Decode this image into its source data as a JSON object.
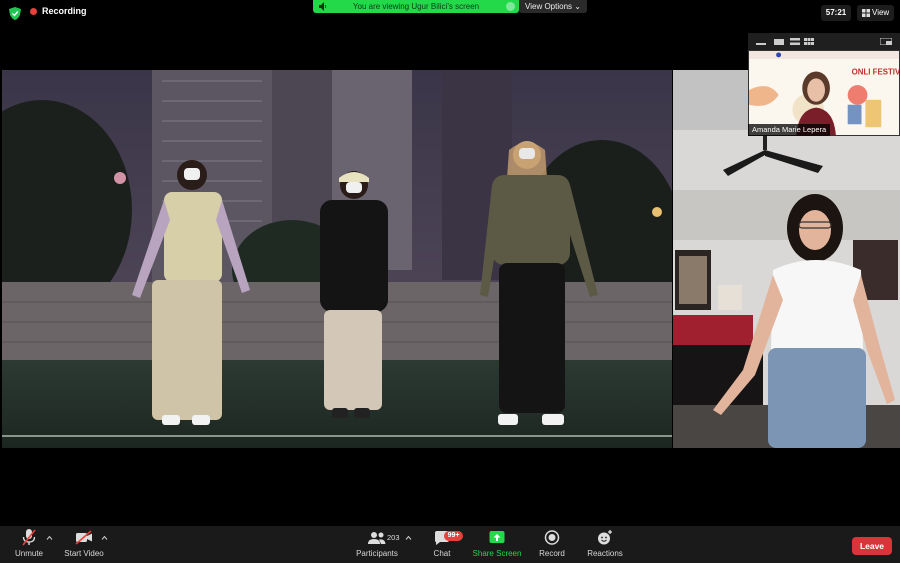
{
  "meeting": {
    "recording_label": "Recording",
    "viewing_banner": "You are viewing Ugur Bilici's screen",
    "view_options_label": "View Options",
    "timer": "57:21",
    "view_label": "View"
  },
  "thumbnail": {
    "participant_name": "Amanda Marie Lepera",
    "background_text": "ONLI FESTIVAL"
  },
  "toolbar": {
    "unmute_label": "Unmute",
    "start_video_label": "Start Video",
    "participants_label": "Participants",
    "participants_count": "203",
    "chat_label": "Chat",
    "chat_badge": "99+",
    "share_screen_label": "Share Screen",
    "record_label": "Record",
    "reactions_label": "Reactions",
    "leave_label": "Leave"
  },
  "colors": {
    "banner_green": "#23d94a",
    "recording_red": "#e8403a",
    "leave_red": "#d8343a",
    "toolbar_bg": "#1a1a1a"
  }
}
